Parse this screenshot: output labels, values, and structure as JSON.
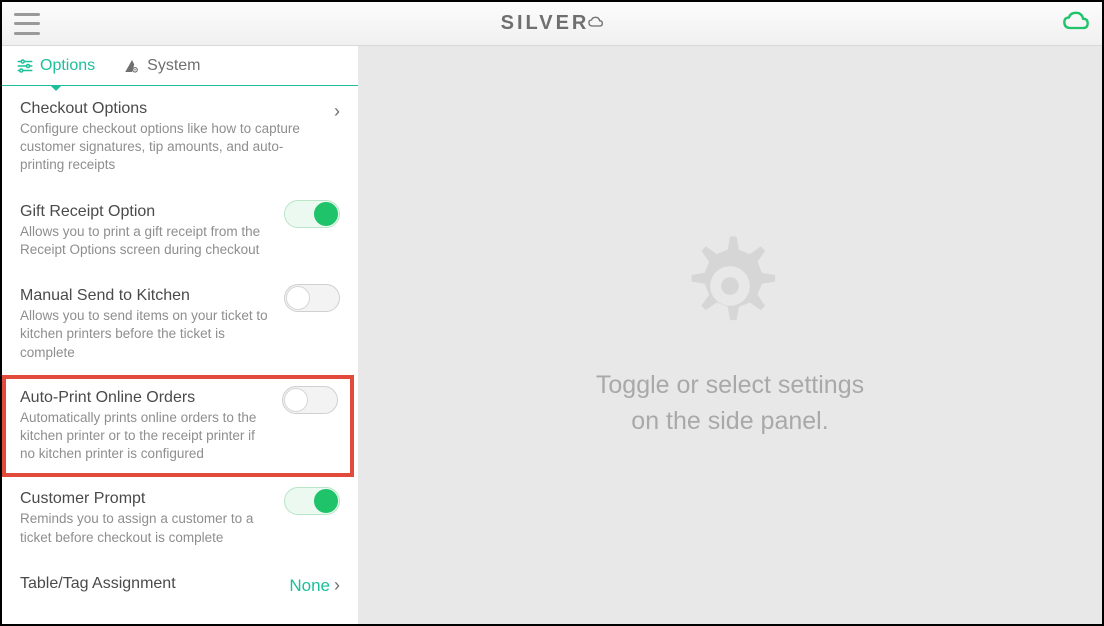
{
  "header": {
    "brand": "SILVER"
  },
  "tabs": {
    "options": "Options",
    "system": "System"
  },
  "settings": [
    {
      "id": "checkout-options",
      "title": "Checkout Options",
      "desc": "Configure checkout options like how to capture customer signatures, tip amounts, and auto-printing receipts",
      "control": "chevron"
    },
    {
      "id": "gift-receipt",
      "title": "Gift Receipt Option",
      "desc": "Allows you to print a gift receipt from the Receipt Options screen during checkout",
      "control": "toggle",
      "value": true
    },
    {
      "id": "manual-send-kitchen",
      "title": "Manual Send to Kitchen",
      "desc": "Allows you to send items on your ticket to kitchen printers before the ticket is complete",
      "control": "toggle",
      "value": false
    },
    {
      "id": "auto-print-online",
      "title": "Auto-Print Online Orders",
      "desc": "Automatically prints online orders to the kitchen printer or to the receipt printer if no kitchen printer is configured",
      "control": "toggle",
      "value": false,
      "highlight": true
    },
    {
      "id": "customer-prompt",
      "title": "Customer Prompt",
      "desc": "Reminds you to assign a customer to a ticket before checkout is complete",
      "control": "toggle",
      "value": true
    },
    {
      "id": "table-tag-assignment",
      "title": "Table/Tag Assignment",
      "desc": "",
      "control": "value-chevron",
      "valueText": "None"
    }
  ],
  "main": {
    "placeholder_line1": "Toggle or select settings",
    "placeholder_line2": "on the side panel."
  }
}
